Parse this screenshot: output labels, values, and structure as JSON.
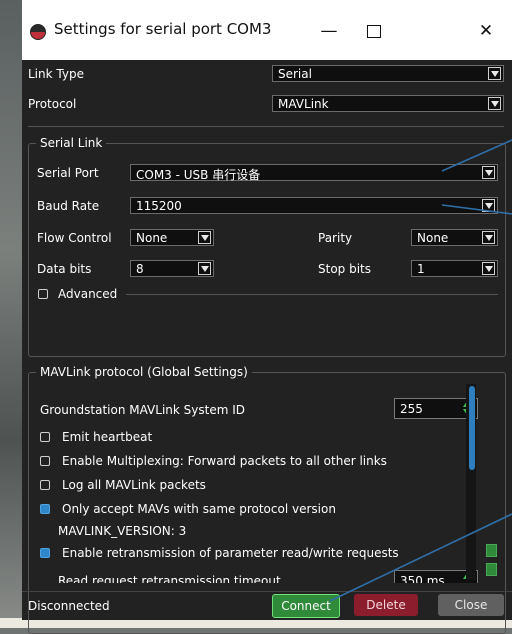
{
  "window": {
    "title": "Settings for serial port COM3",
    "controls": {
      "minimize": "—",
      "close": "✕"
    }
  },
  "link": {
    "link_type_label": "Link Type",
    "link_type_value": "Serial",
    "protocol_label": "Protocol",
    "protocol_value": "MAVLink"
  },
  "serial_link": {
    "group_title": "Serial Link",
    "serial_port_label": "Serial Port",
    "serial_port_value": "COM3 - USB 串行设备",
    "baud_rate_label": "Baud Rate",
    "baud_rate_value": "115200",
    "flow_control_label": "Flow Control",
    "flow_control_value": "None",
    "parity_label": "Parity",
    "parity_value": "None",
    "data_bits_label": "Data bits",
    "data_bits_value": "8",
    "stop_bits_label": "Stop bits",
    "stop_bits_value": "1",
    "advanced_label": "Advanced",
    "advanced_checked": false
  },
  "mavlink": {
    "group_title": "MAVLink protocol (Global Settings)",
    "system_id_label": "Groundstation MAVLink System ID",
    "system_id_value": "255",
    "emit_heartbeat_label": "Emit heartbeat",
    "multiplexing_label": "Enable Multiplexing: Forward packets to all other links",
    "log_packets_label": "Log all MAVLink packets",
    "only_accept_label": "Only accept MAVs with same protocol version",
    "version_text": "MAVLINK_VERSION: 3",
    "retransmission_label": "Enable retransmission of parameter read/write requests",
    "read_timeout_label": "Read request retransmission timeout",
    "read_timeout_value": "350 ms",
    "checkbox_states": {
      "emit_heartbeat": false,
      "multiplexing": false,
      "log_packets": false,
      "only_accept": true,
      "retransmission": true
    }
  },
  "footer": {
    "status": "Disconnected",
    "connect_label": "Connect",
    "delete_label": "Delete",
    "close_label": "Close"
  },
  "colors": {
    "panel_bg": "#222222",
    "accent_blue": "#2f86c8",
    "connect_green": "#2f8a39",
    "delete_red": "#8b1d2c",
    "annotation_line": "#2f6fa8"
  }
}
